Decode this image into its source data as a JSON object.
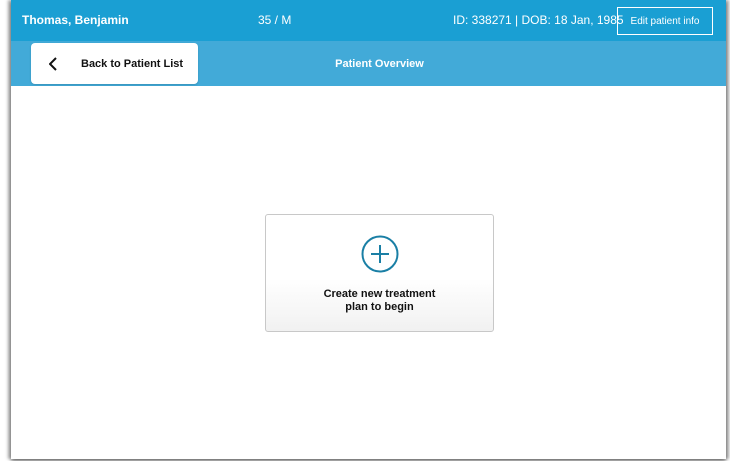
{
  "patient": {
    "name": "Thomas, Benjamin",
    "age_sex": "35 / M",
    "id_dob": "ID: 338271 | DOB: 18 Jan, 1985",
    "edit_label": "Edit patient info"
  },
  "nav": {
    "back_label": "Back to Patient List",
    "title": "Patient Overview"
  },
  "main": {
    "create_line1": "Create new treatment",
    "create_line2": "plan to begin"
  },
  "icons": {
    "back": "chevron-left-icon",
    "create": "plus-circle-icon"
  },
  "colors": {
    "header": "#1a9fd3",
    "nav": "#42aad8",
    "accent": "#1a7fa5"
  }
}
